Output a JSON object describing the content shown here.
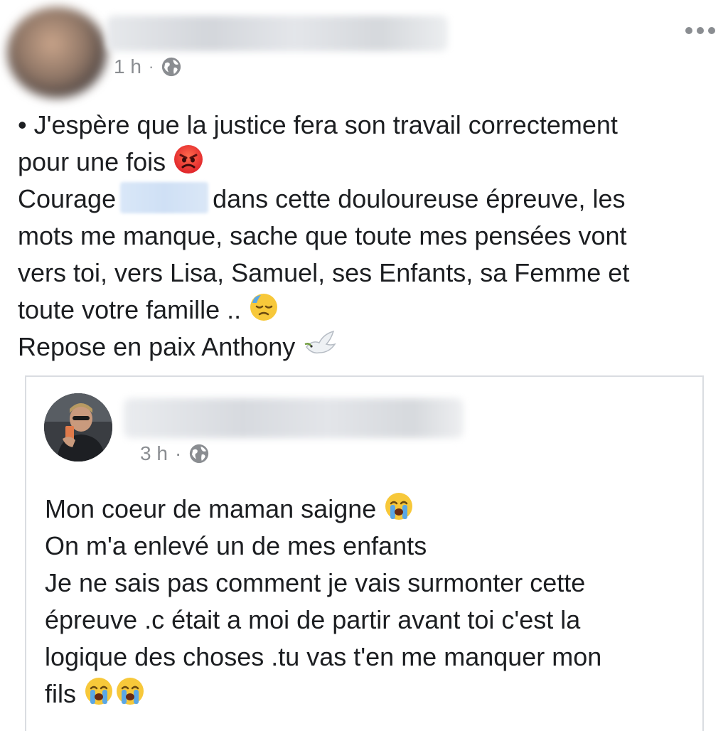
{
  "post": {
    "time": "1 h",
    "separator": "·",
    "lines": {
      "l1": "• J'espère que la justice fera son travail correctement",
      "l2": "pour une fois",
      "l3a": "Courage",
      "l3b": "dans cette douloureuse épreuve, les",
      "l4": "mots me manque, sache que toute mes pensées vont",
      "l5": "vers toi, vers Lisa, Samuel, ses Enfants, sa Femme et",
      "l6": "toute votre famille ..",
      "l7": "Repose en paix Anthony"
    },
    "emojis": {
      "angry": "angry-face-emoji",
      "sad": "downcast-sweat-face-emoji",
      "dove": "dove-emoji"
    }
  },
  "shared_post": {
    "time": "3 h",
    "separator": "·",
    "lines": {
      "l1": "Mon coeur de maman saigne",
      "l2": "On m'a enlevé un de mes enfants",
      "l3": "Je ne sais pas comment je vais surmonter cette",
      "l4": "épreuve .c était a moi de partir avant toi c'est la",
      "l5": "logique des choses .tu vas t'en me manquer mon",
      "l6": "fils"
    },
    "emojis": {
      "crying": "loudly-crying-face-emoji"
    }
  },
  "icons": {
    "more": "more-options-icon",
    "audience": "globe-icon"
  },
  "colors": {
    "text": "#1c1e21",
    "meta": "#8a8d91",
    "border": "#dadde1",
    "mention": "#cfe0f5"
  }
}
